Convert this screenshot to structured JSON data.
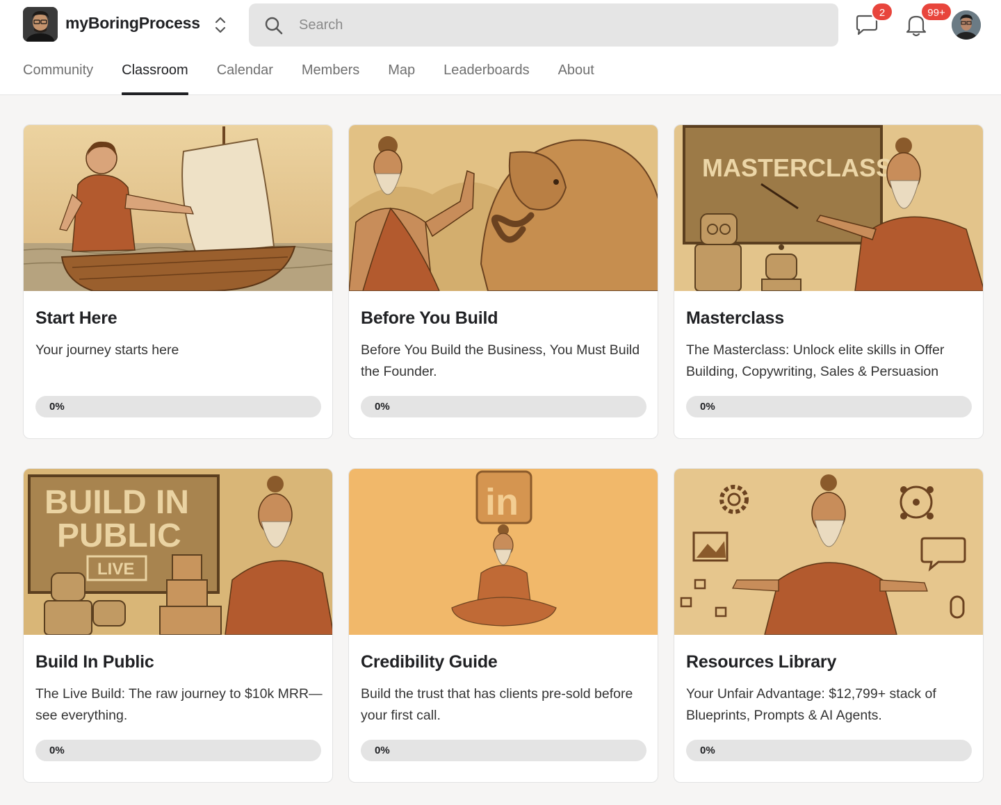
{
  "header": {
    "app_name": "myBoringProcess",
    "search": {
      "placeholder": "Search",
      "value": ""
    },
    "chat_badge": "2",
    "notification_badge": "99+",
    "icons": [
      "switcher-icon",
      "search-icon",
      "chat-icon",
      "bell-icon",
      "user-avatar"
    ]
  },
  "nav": {
    "tabs": [
      {
        "label": "Community",
        "active": false
      },
      {
        "label": "Classroom",
        "active": true
      },
      {
        "label": "Calendar",
        "active": false
      },
      {
        "label": "Members",
        "active": false
      },
      {
        "label": "Map",
        "active": false
      },
      {
        "label": "Leaderboards",
        "active": false
      },
      {
        "label": "About",
        "active": false
      }
    ]
  },
  "courses": [
    {
      "title": "Start Here",
      "description": "Your journey starts here",
      "progress_label": "0%",
      "progress": 0,
      "image": "boat-illustration"
    },
    {
      "title": "Before You Build",
      "description": "Before You Build the Business, You Must Build the Founder.",
      "progress_label": "0%",
      "progress": 0,
      "image": "sage-elephant-illustration"
    },
    {
      "title": "Masterclass",
      "description": "The Masterclass: Unlock elite skills in Offer Building, Copywriting, Sales & Persuasion",
      "progress_label": "0%",
      "progress": 0,
      "image": "masterclass-illustration",
      "image_text": "MASTERCLASS"
    },
    {
      "title": "Build In Public",
      "description": "The Live Build: The raw journey to $10k MRR—see everything.",
      "progress_label": "0%",
      "progress": 0,
      "image": "build-in-public-illustration",
      "image_text": [
        "BUILD IN",
        "PUBLIC",
        "LIVE"
      ]
    },
    {
      "title": "Credibility Guide",
      "description": "Build the trust that has clients pre-sold before your first call.",
      "progress_label": "0%",
      "progress": 0,
      "image": "meditating-sage-linkedin-illustration",
      "image_text": "in"
    },
    {
      "title": "Resources Library",
      "description": "Your Unfair Advantage: $12,799+ stack of Blueprints, Prompts & AI Agents.",
      "progress_label": "0%",
      "progress": 0,
      "image": "resources-sage-illustration"
    }
  ],
  "colors": {
    "accent": "#202124",
    "badge": "#e8453c",
    "progress_track": "#e4e4e4",
    "page_bg": "#f6f5f4",
    "sepia_light": "#e9cf97",
    "sepia_dark": "#8a5a2b"
  }
}
